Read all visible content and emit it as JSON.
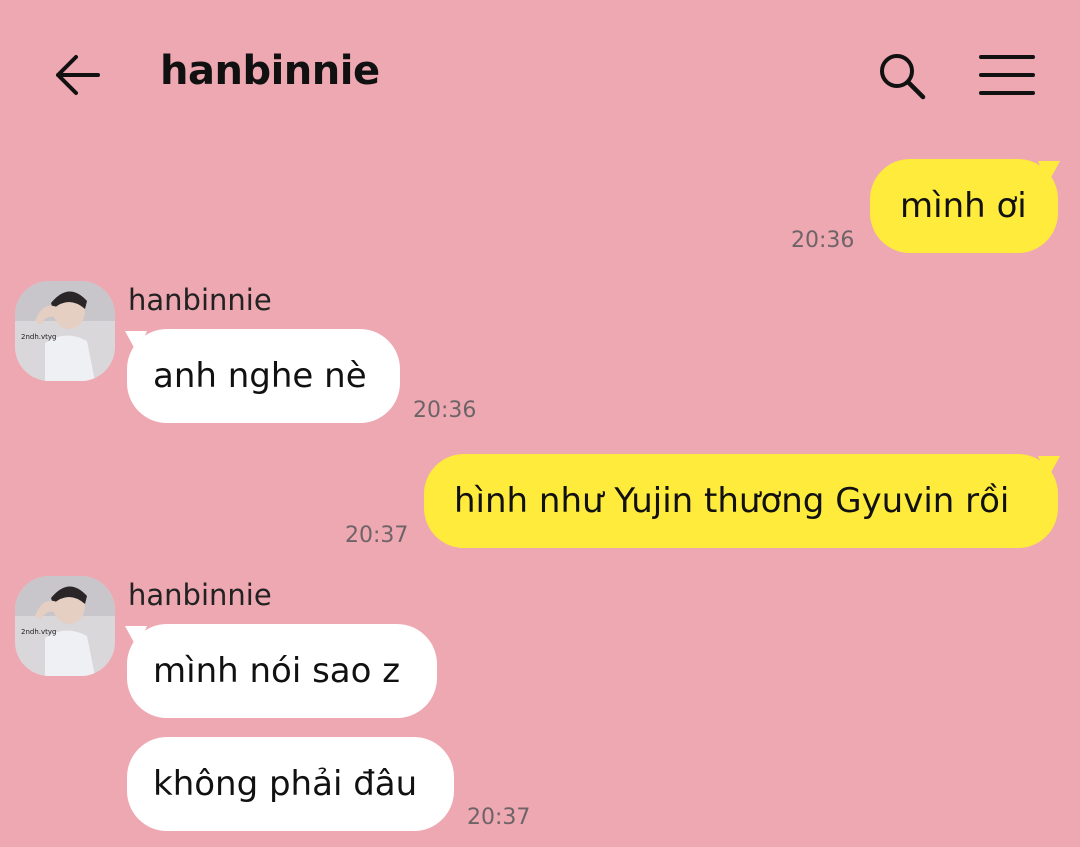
{
  "header": {
    "title": "hanbinnie",
    "back_icon": "arrow-left-icon",
    "search_icon": "search-icon",
    "menu_icon": "hamburger-menu-icon"
  },
  "colors": {
    "background": "#eea8b2",
    "my_bubble": "#ffeb3b",
    "their_bubble": "#ffffff"
  },
  "messages": [
    {
      "from": "me",
      "text": "mình ơi",
      "time": "20:36"
    },
    {
      "from": "hanbinnie",
      "sender": "hanbinnie",
      "text": "anh nghe nè",
      "time": "20:36"
    },
    {
      "from": "me",
      "text": "hình như Yujin thương Gyuvin rồi",
      "time": "20:37"
    },
    {
      "from": "hanbinnie",
      "sender": "hanbinnie",
      "text": "mình nói sao z",
      "time": ""
    },
    {
      "from": "hanbinnie",
      "text": "không phải đâu",
      "time": "20:37"
    }
  ]
}
